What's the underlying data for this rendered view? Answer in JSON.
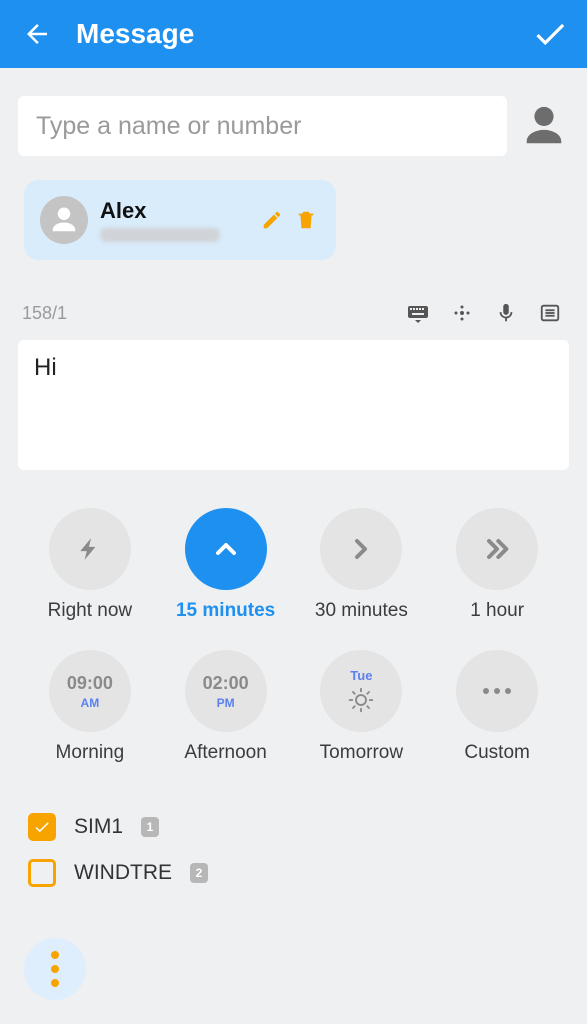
{
  "header": {
    "title": "Message"
  },
  "recipient_input": {
    "placeholder": "Type a name or number",
    "value": ""
  },
  "contact_chip": {
    "name": "Alex"
  },
  "compose": {
    "counter": "158/1",
    "value": "Hi"
  },
  "schedule": [
    {
      "id": "now",
      "label": "Right now",
      "kind": "bolt",
      "selected": false
    },
    {
      "id": "15m",
      "label": "15 minutes",
      "kind": "up",
      "selected": true
    },
    {
      "id": "30m",
      "label": "30 minutes",
      "kind": "right",
      "selected": false
    },
    {
      "id": "1h",
      "label": "1 hour",
      "kind": "dbl",
      "selected": false
    },
    {
      "id": "morning",
      "label": "Morning",
      "kind": "time",
      "time": "09:00",
      "ampm": "AM",
      "selected": false
    },
    {
      "id": "afternoon",
      "label": "Afternoon",
      "kind": "time",
      "time": "02:00",
      "ampm": "PM",
      "selected": false
    },
    {
      "id": "tomorrow",
      "label": "Tomorrow",
      "kind": "tmr",
      "top": "Tue",
      "selected": false
    },
    {
      "id": "custom",
      "label": "Custom",
      "kind": "dots",
      "selected": false
    }
  ],
  "sims": [
    {
      "label": "SIM1",
      "checked": true,
      "badge": "1"
    },
    {
      "label": "WINDTRE",
      "checked": false,
      "badge": "2"
    }
  ]
}
